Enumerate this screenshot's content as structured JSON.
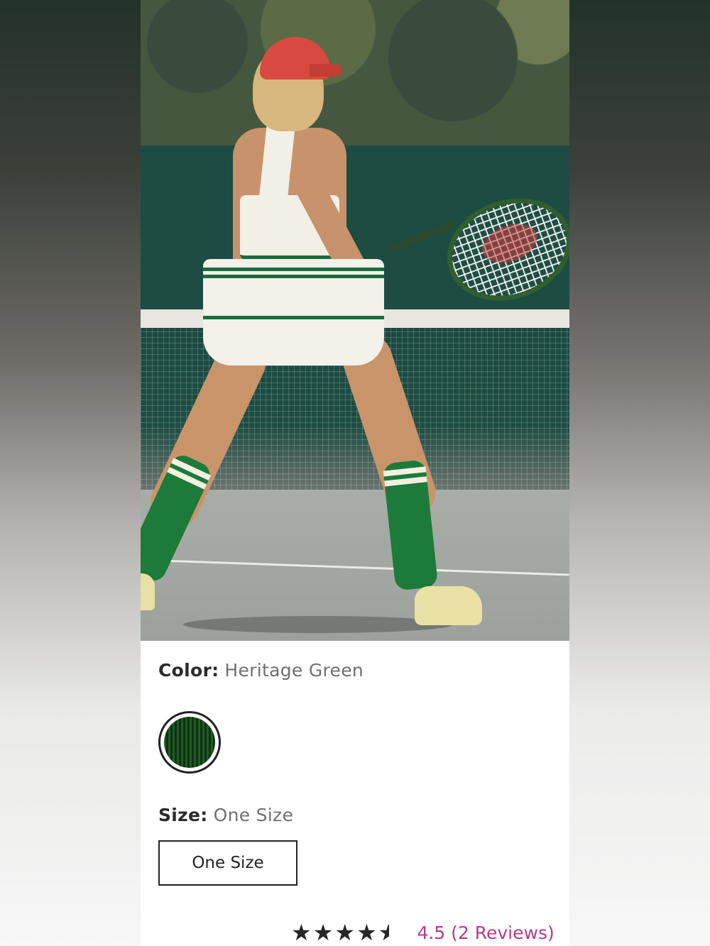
{
  "product_image": {
    "alt_subject": "tennis-player-photo"
  },
  "color": {
    "label": "Color:",
    "value": "Heritage Green",
    "swatch_name": "heritage-green",
    "swatch_color": "#1f5a24"
  },
  "size": {
    "label": "Size:",
    "value": "One Size",
    "options": [
      "One Size"
    ]
  },
  "rating": {
    "score": 4.5,
    "max": 5,
    "stars_glyphs": "★★★★★",
    "text": "4.5 (2 Reviews)"
  },
  "colors": {
    "review_link": "#b43c86",
    "text_dark": "#2b2b2b",
    "text_muted": "#707070"
  }
}
